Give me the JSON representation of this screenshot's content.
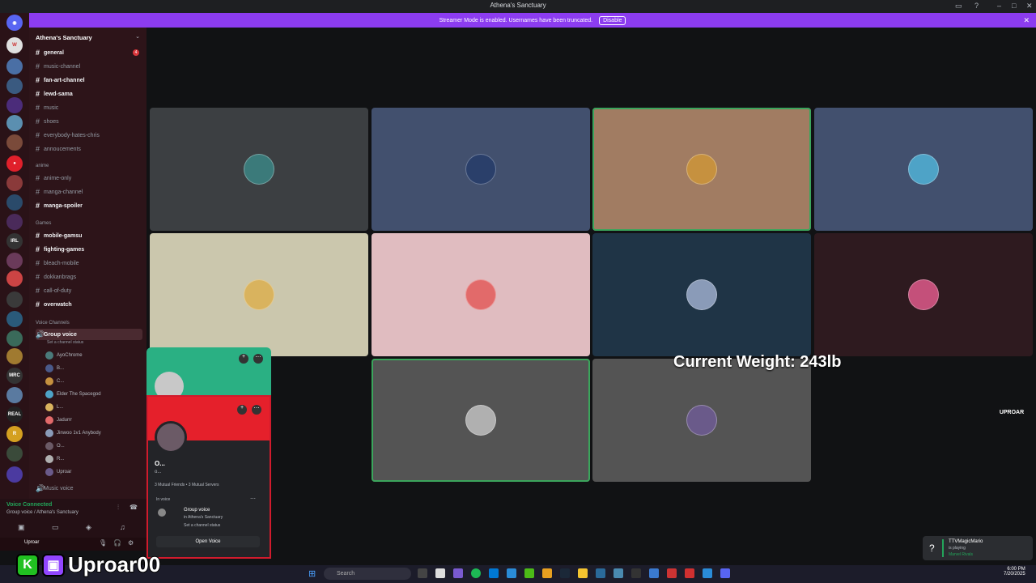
{
  "window": {
    "title": "Athena's Sanctuary"
  },
  "banner": {
    "text": "Streamer Mode is enabled. Usernames have been truncated.",
    "button": "Disable"
  },
  "server": {
    "name": "Athena's Sanctuary"
  },
  "channels": [
    {
      "name": "general",
      "unread": true,
      "badge": "4"
    },
    {
      "name": "music-channel",
      "unread": false
    },
    {
      "name": "fan-art-channel",
      "unread": true
    },
    {
      "name": "lewd-sama",
      "unread": true
    },
    {
      "name": "music",
      "unread": false
    },
    {
      "name": "shoes",
      "unread": false
    },
    {
      "name": "everybody-hates-chris",
      "unread": false
    },
    {
      "name": "annoucements",
      "unread": false
    }
  ],
  "category_anime": {
    "label": "anime"
  },
  "anime_channels": [
    {
      "name": "anime-only",
      "unread": false
    },
    {
      "name": "manga-channel",
      "unread": false
    },
    {
      "name": "manga-spoiler",
      "unread": true
    }
  ],
  "category_games": {
    "label": "Games"
  },
  "games_channels": [
    {
      "name": "mobile-gamsu",
      "unread": true
    },
    {
      "name": "fighting-games",
      "unread": true
    },
    {
      "name": "bleach-mobile",
      "unread": false
    },
    {
      "name": "dokkanbrags",
      "unread": false
    },
    {
      "name": "call-of-duty",
      "unread": false
    },
    {
      "name": "overwatch",
      "unread": true
    }
  ],
  "category_voice": {
    "label": "Voice Channels"
  },
  "voice_channel": {
    "name": "Group voice",
    "status": "Set a channel status"
  },
  "voice_users": [
    {
      "name": "AyoChrome"
    },
    {
      "name": "B..."
    },
    {
      "name": "C..."
    },
    {
      "name": "Elder The Spacegod"
    },
    {
      "name": "L..."
    },
    {
      "name": "Jadurrr"
    },
    {
      "name": "Jinwoo 1v1 Anybody"
    },
    {
      "name": "O..."
    },
    {
      "name": "R..."
    },
    {
      "name": "Uproar"
    }
  ],
  "music_voice": {
    "name": "Music voice"
  },
  "voice_connected": {
    "title": "Voice Connected",
    "subtitle": "Group voice / Athena's Sanctuary"
  },
  "user_panel": {
    "name": "Uproar"
  },
  "popout": {
    "username": "O...",
    "tag": "o...",
    "mutuals": "3 Mutual Friends • 3 Mutual Servers",
    "section": "In voice",
    "vc_name": "Group voice",
    "vc_server": "in Athena's Sanctuary",
    "vc_status": "Set a channel status",
    "open_button": "Open Voice"
  },
  "tiles": [
    {
      "color": "#3c3f42",
      "avatar": "#3b7a7a",
      "speaking": false
    },
    {
      "color": "#42506e",
      "avatar": "#2a3f6a",
      "speaking": false
    },
    {
      "color": "#a17c62",
      "avatar": "#c6913f",
      "speaking": true
    },
    {
      "color": "#42506e",
      "avatar": "#4ea3c7",
      "speaking": false
    },
    {
      "color": "#cbc7ad",
      "avatar": "#d9b35e",
      "speaking": false
    },
    {
      "color": "#e0bcc0",
      "avatar": "#e26a6a",
      "speaking": false
    },
    {
      "color": "#1f3446",
      "avatar": "#8a9bb8",
      "speaking": false
    },
    {
      "color": "#2e1a1f",
      "avatar": "#c4507a",
      "speaking": false
    },
    {
      "color": "#545454",
      "avatar": "#b0b0b0",
      "speaking": true
    },
    {
      "color": "#545454",
      "avatar": "#6a5a8a",
      "speaking": false
    }
  ],
  "overlay": {
    "weight": "Current Weight: 243lb",
    "streamer": "Uproar00",
    "logo": "UPROAR"
  },
  "notification": {
    "name": "TTVMagicMario",
    "status": "is playing",
    "game": "Marvel Rivals"
  },
  "taskbar": {
    "search": "Search",
    "time": "6:00 PM",
    "date": "7/20/2025"
  }
}
